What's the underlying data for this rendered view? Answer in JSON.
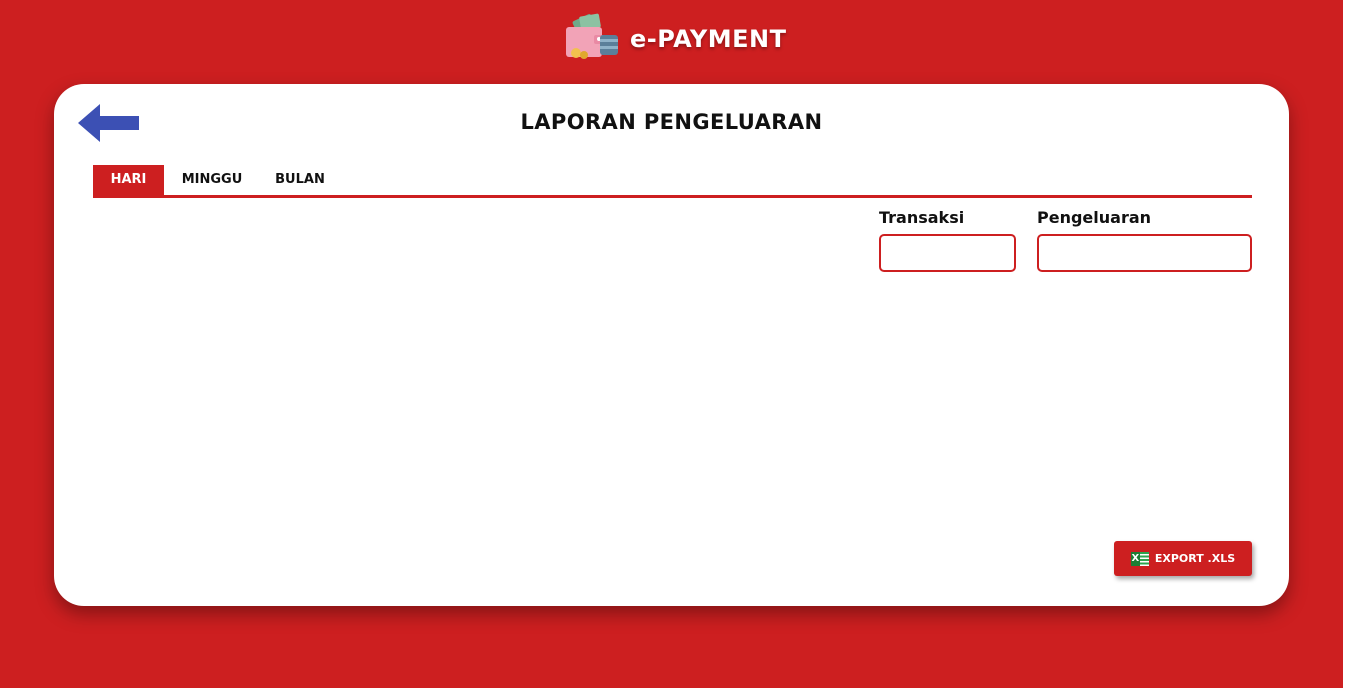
{
  "app": {
    "brand_name": "e-PAYMENT",
    "logo_icon": "wallet-cards-money-icon"
  },
  "colors": {
    "primary_red": "#cd1f20",
    "back_arrow": "#3c50b4",
    "card_bg": "#ffffff"
  },
  "page": {
    "title": "LAPORAN PENGELUARAN",
    "back_icon": "arrow-left-icon"
  },
  "tabs": [
    {
      "label": "HARI",
      "active": true
    },
    {
      "label": "MINGGU",
      "active": false
    },
    {
      "label": "BULAN",
      "active": false
    }
  ],
  "summary": {
    "transaksi_label": "Transaksi",
    "transaksi_value": "",
    "pengeluaran_label": "Pengeluaran",
    "pengeluaran_value": ""
  },
  "export": {
    "label": "EXPORT .XLS",
    "icon": "excel-icon"
  }
}
